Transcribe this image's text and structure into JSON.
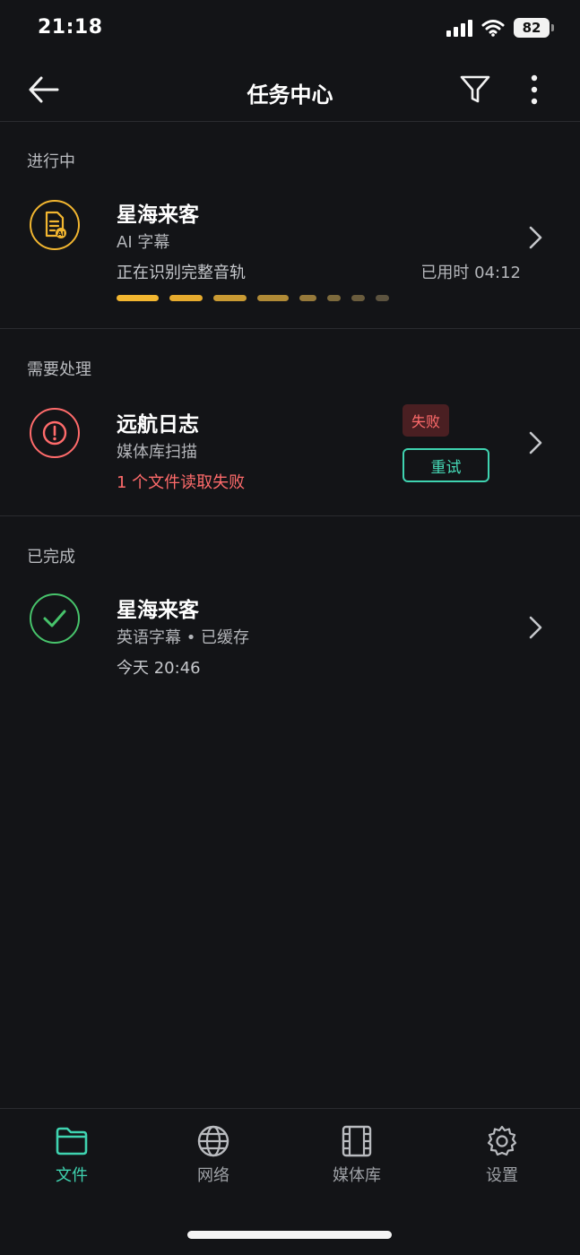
{
  "status_bar": {
    "time": "21:18",
    "battery": "82"
  },
  "header": {
    "title": "任务中心"
  },
  "sections": {
    "in_progress": {
      "label": "进行中",
      "item": {
        "title": "星海来客",
        "subtitle": "AI 字幕",
        "status": "正在识别完整音轨",
        "elapsed": "已用时 04:12"
      }
    },
    "needs_action": {
      "label": "需要处理",
      "item": {
        "title": "远航日志",
        "subtitle": "媒体库扫描",
        "error": "1 个文件读取失败",
        "badge": "失败",
        "retry_label": "重试"
      }
    },
    "completed": {
      "label": "已完成",
      "item": {
        "title": "星海来客",
        "subtitle": "英语字幕 • 已缓存",
        "time": "今天 20:46"
      }
    }
  },
  "bottom_nav": [
    {
      "label": "文件",
      "icon": "folder-icon",
      "active": true
    },
    {
      "label": "网络",
      "icon": "globe-icon",
      "active": false
    },
    {
      "label": "媒体库",
      "icon": "film-icon",
      "active": false
    },
    {
      "label": "设置",
      "icon": "gear-icon",
      "active": false
    }
  ],
  "colors": {
    "accent": "#3fd3b0",
    "progress": "#f2b630",
    "error": "#ff6b6b",
    "success": "#47c36b",
    "background": "#131417"
  }
}
